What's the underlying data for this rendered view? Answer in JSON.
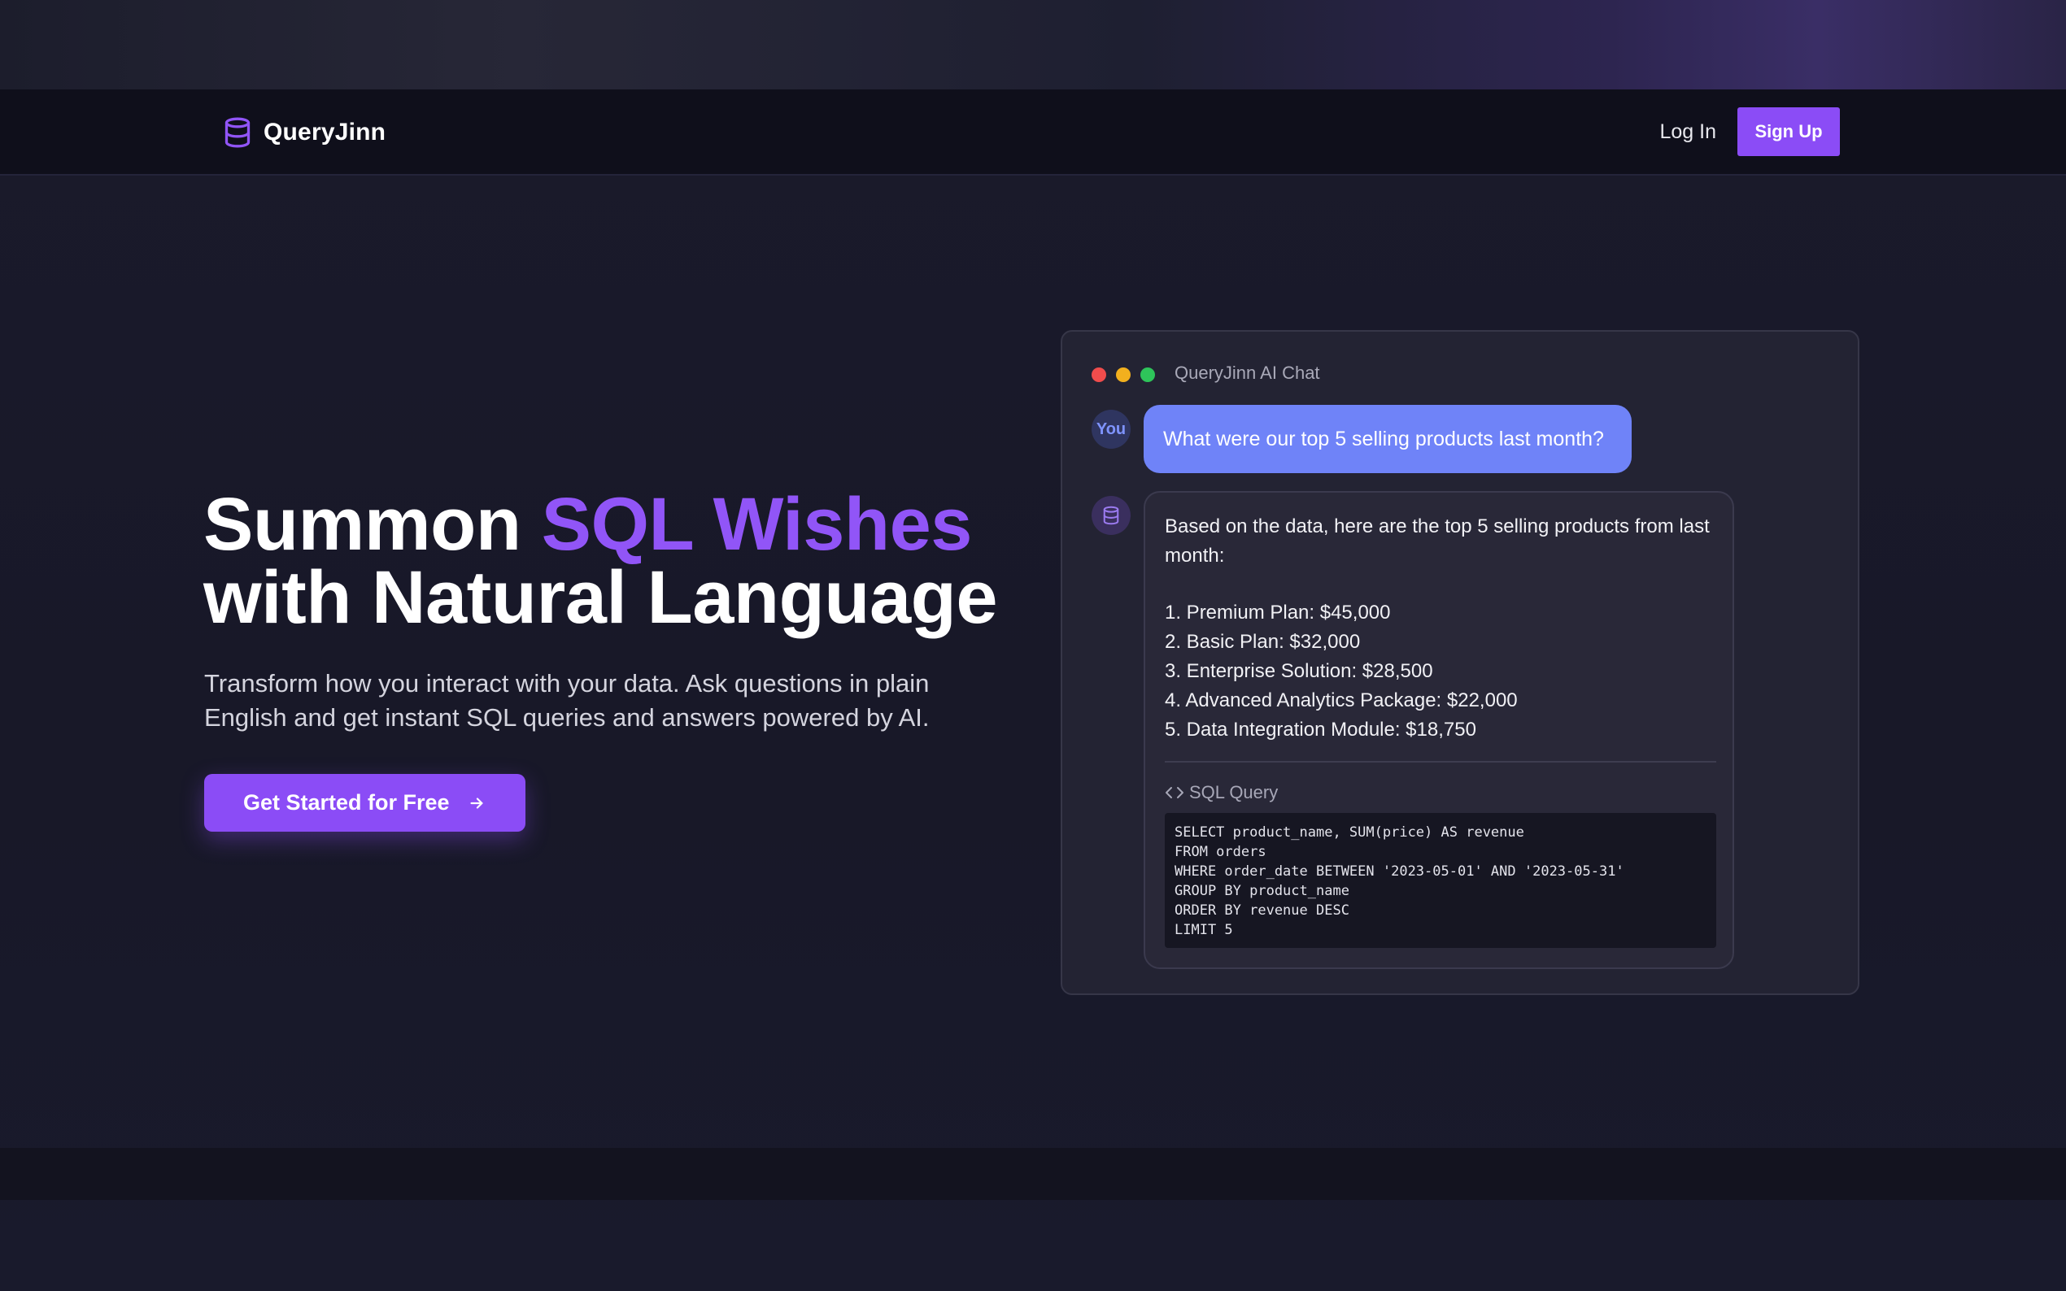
{
  "brand": {
    "name": "QueryJinn",
    "icon": "database-icon",
    "accent_color": "#8b4cf6"
  },
  "nav": {
    "login_label": "Log In",
    "signup_label": "Sign Up"
  },
  "hero": {
    "title_part1": "Summon ",
    "title_accent": "SQL Wishes",
    "title_part2": "with Natural Language",
    "subtitle": "Transform how you interact with your data. Ask questions in plain English and get instant SQL queries and answers powered by AI.",
    "cta_label": "Get Started for Free",
    "cta_icon": "arrow-right-icon"
  },
  "chat": {
    "window_title": "QueryJinn AI Chat",
    "window_dots": [
      "#f04c4c",
      "#f2b01e",
      "#2ec45a"
    ],
    "user_avatar_label": "You",
    "user_message": "What were our top 5 selling products last month?",
    "bot_avatar_icon": "database-icon",
    "bot_intro": "Based on the data, here are the top 5 selling products from last month:",
    "bot_list": [
      "1. Premium Plan: $45,000",
      "2. Basic Plan: $32,000",
      "3. Enterprise Solution: $28,500",
      "4. Advanced Analytics Package: $22,000",
      "5. Data Integration Module: $18,750"
    ],
    "sql_label": "SQL Query",
    "sql_icon": "code-icon",
    "sql_lines": [
      "SELECT product_name, SUM(price) AS revenue",
      "FROM orders",
      "WHERE order_date BETWEEN '2023-05-01' AND '2023-05-31'",
      "GROUP BY product_name",
      "ORDER BY revenue DESC",
      "LIMIT 5"
    ]
  }
}
